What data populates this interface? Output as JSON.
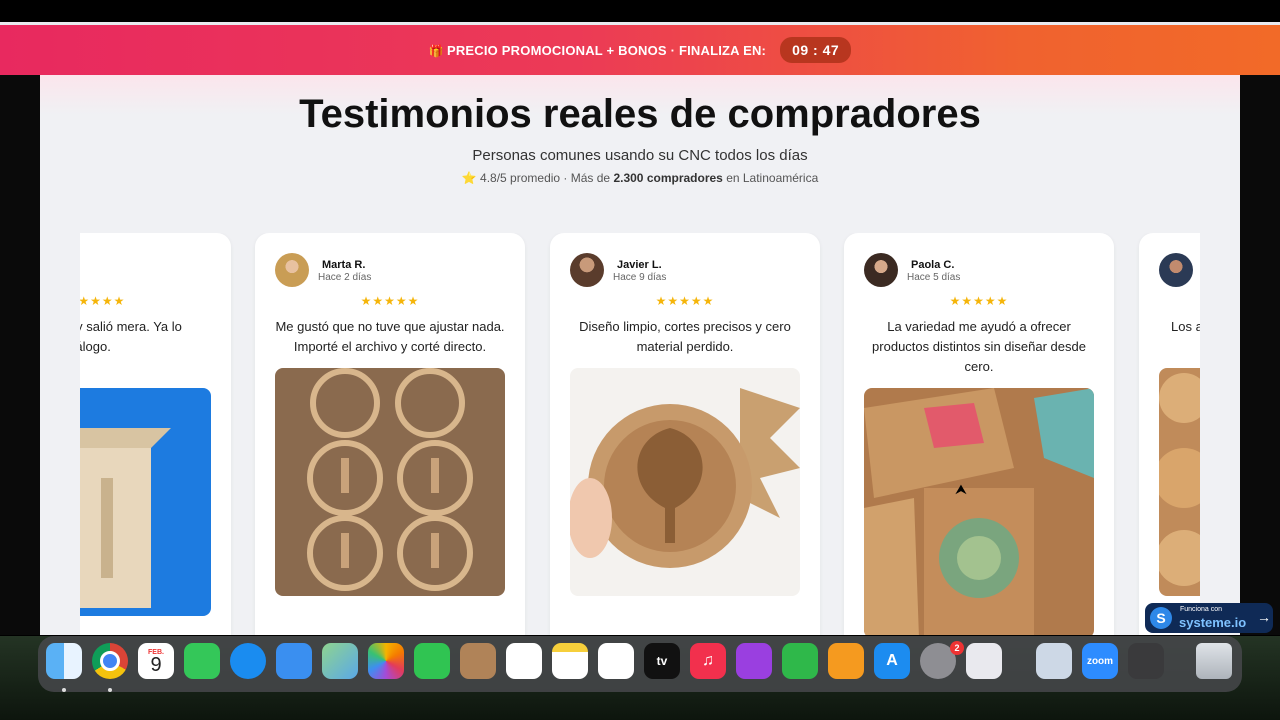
{
  "promo": {
    "gift_icon": "🎁",
    "text": "PRECIO PROMOCIONAL + BONOS · FINALIZA EN:",
    "timer": "09 : 47"
  },
  "header": {
    "title": "Testimonios reales de compradores",
    "subtitle": "Personas comunes usando su CNC todos los días",
    "rating_star": "⭐",
    "rating_prefix": "4.8/5 promedio · Más de",
    "rating_count": "2.300 compradores",
    "rating_suffix": "en Latinoamérica"
  },
  "testimonials": [
    {
      "name": ".",
      "time": "",
      "stars": "★★★★★",
      "quote": "eño en MDF y salió mera. Ya lo sumé a mi atálogo."
    },
    {
      "name": "Marta R.",
      "time": "Hace 2 días",
      "stars": "★★★★★",
      "quote": "Me gustó que no tuve que ajustar nada. Importé el archivo y corté directo."
    },
    {
      "name": "Javier L.",
      "time": "Hace 9 días",
      "stars": "★★★★★",
      "quote": "Diseño limpio, cortes precisos y cero material perdido."
    },
    {
      "name": "Paola C.",
      "time": "Hace 5 días",
      "stars": "★★★★★",
      "quote": "La variedad me ayudó a ofrecer productos distintos sin diseñar desde cero."
    },
    {
      "name": "",
      "time": "",
      "stars": "",
      "quote": "Los a l"
    }
  ],
  "systeme": {
    "small": "Funciona con",
    "big": "systeme.io",
    "logo": "S",
    "arrow": "→"
  },
  "dock": {
    "calendar_month": "FEB.",
    "calendar_day": "9",
    "settings_badge": "2",
    "apps": [
      "finder-icon",
      "chrome-icon",
      "calendar-icon",
      "messages-icon",
      "safari-icon",
      "mail-icon",
      "maps-icon",
      "photos-icon",
      "facetime-icon",
      "contacts-icon",
      "reminders-icon",
      "notes-icon",
      "freeform-icon",
      "appletv-icon",
      "music-icon",
      "podcasts-icon",
      "numbers-icon",
      "pages-icon",
      "appstore-icon",
      "settings-icon",
      "iphone-mirroring-icon",
      "preview-icon",
      "zoom-icon",
      "calculator-icon",
      "trash-icon"
    ],
    "zoom_label": "zoom"
  }
}
